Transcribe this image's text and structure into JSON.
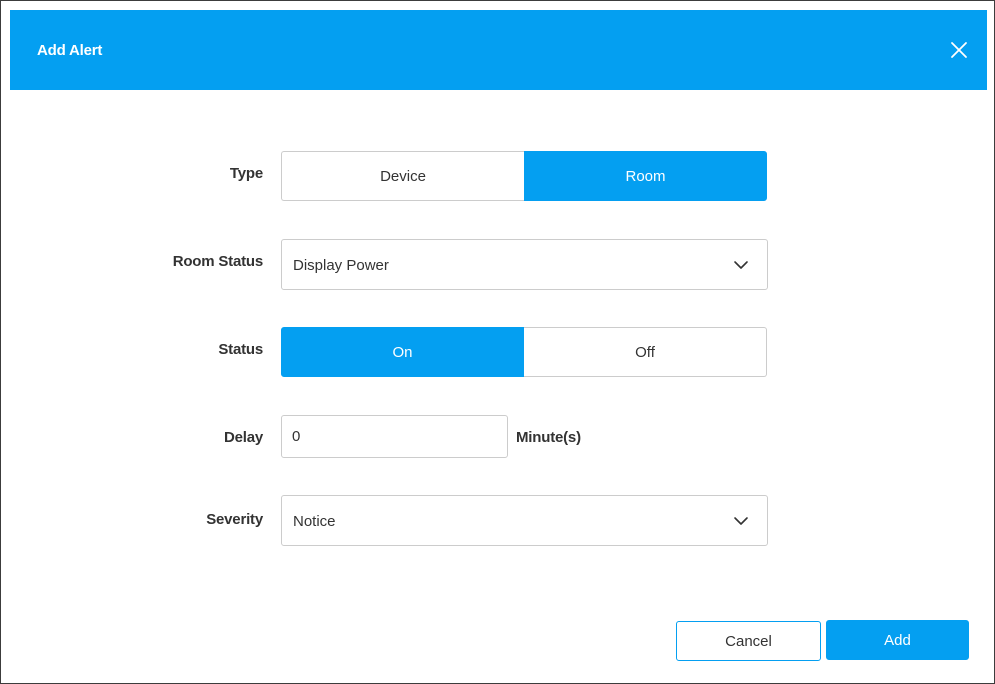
{
  "dialog": {
    "title": "Add Alert",
    "close_icon": "close-icon"
  },
  "form": {
    "type": {
      "label": "Type",
      "options": [
        "Device",
        "Room"
      ],
      "selected": "Room"
    },
    "room_status": {
      "label": "Room Status",
      "value": "Display Power",
      "icon": "chevron-down-icon"
    },
    "status": {
      "label": "Status",
      "options": [
        "On",
        "Off"
      ],
      "selected": "On"
    },
    "delay": {
      "label": "Delay",
      "value": "0",
      "unit": "Minute(s)"
    },
    "severity": {
      "label": "Severity",
      "value": "Notice",
      "icon": "chevron-down-icon"
    }
  },
  "footer": {
    "cancel_label": "Cancel",
    "add_label": "Add"
  },
  "colors": {
    "accent": "#049ff1",
    "border": "#cccccc",
    "text": "#333333"
  }
}
